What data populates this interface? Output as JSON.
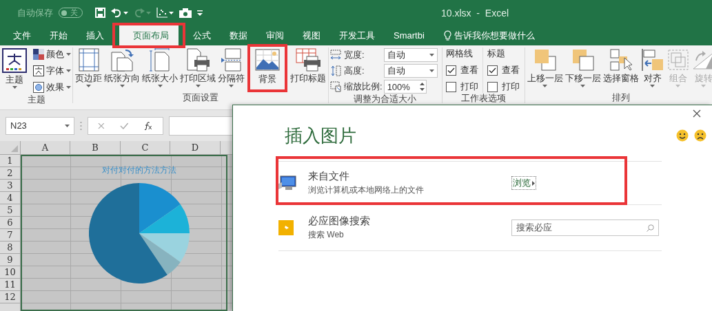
{
  "title_bar": {
    "autosave": {
      "label": "自动保存",
      "state_label": "关",
      "on": false
    },
    "title": "10.xlsx  -  Excel"
  },
  "tabs": [
    {
      "label": "文件",
      "selected": false,
      "highlighted": false
    },
    {
      "label": "开始",
      "selected": false,
      "highlighted": false
    },
    {
      "label": "插入",
      "selected": false,
      "highlighted": false
    },
    {
      "label": "页面布局",
      "selected": true,
      "highlighted": true
    },
    {
      "label": "公式",
      "selected": false,
      "highlighted": false
    },
    {
      "label": "数据",
      "selected": false,
      "highlighted": false
    },
    {
      "label": "审阅",
      "selected": false,
      "highlighted": false
    },
    {
      "label": "视图",
      "selected": false,
      "highlighted": false
    },
    {
      "label": "开发工具",
      "selected": false,
      "highlighted": false
    },
    {
      "label": "Smartbi",
      "selected": false,
      "highlighted": false
    }
  ],
  "tell_me": "告诉我你想要做什么",
  "ribbon": [
    {
      "label": "主题",
      "items": [
        {
          "kind": "large",
          "label": "主题",
          "menu": true,
          "disabled": false,
          "highlighted": false
        },
        {
          "kind": "stack",
          "items": [
            {
              "label": "颜色"
            },
            {
              "label": "字体"
            },
            {
              "label": "效果"
            }
          ]
        }
      ]
    },
    {
      "label": "页面设置",
      "items": [
        {
          "kind": "large",
          "label": "页边距",
          "menu": true,
          "disabled": false,
          "highlighted": false
        },
        {
          "kind": "large",
          "label": "纸张方向",
          "menu": true,
          "disabled": false,
          "highlighted": false
        },
        {
          "kind": "large",
          "label": "纸张大小",
          "menu": true,
          "disabled": false,
          "highlighted": false
        },
        {
          "kind": "large",
          "label": "打印区域",
          "menu": true,
          "disabled": false,
          "highlighted": false
        },
        {
          "kind": "large",
          "label": "分隔符",
          "menu": true,
          "disabled": false,
          "highlighted": false
        },
        {
          "kind": "large",
          "label": "背景",
          "menu": false,
          "disabled": false,
          "highlighted": true
        },
        {
          "kind": "large",
          "label": "打印标题",
          "menu": false,
          "disabled": false,
          "highlighted": false
        }
      ]
    },
    {
      "label": "调整为合适大小",
      "items": [
        {
          "kind": "fields",
          "items": [
            {
              "label": "宽度:",
              "value": "自动",
              "kind": "combo"
            },
            {
              "label": "高度:",
              "value": "自动",
              "kind": "combo"
            },
            {
              "label": "缩放比例:",
              "value": "100%",
              "kind": "spinner"
            }
          ]
        }
      ]
    },
    {
      "label": "工作表选项",
      "items": [
        {
          "kind": "checks",
          "header": "网格线",
          "items": [
            {
              "label": "查看",
              "checked": true
            },
            {
              "label": "打印",
              "checked": false
            }
          ]
        },
        {
          "kind": "checks",
          "header": "标题",
          "items": [
            {
              "label": "查看",
              "checked": true
            },
            {
              "label": "打印",
              "checked": false
            }
          ]
        }
      ]
    },
    {
      "label": "排列",
      "items": [
        {
          "kind": "large",
          "label": "上移一层",
          "menu": true,
          "disabled": false,
          "highlighted": false
        },
        {
          "kind": "large",
          "label": "下移一层",
          "menu": true,
          "disabled": false,
          "highlighted": false
        },
        {
          "kind": "large",
          "label": "选择窗格",
          "menu": false,
          "disabled": false,
          "highlighted": false
        },
        {
          "kind": "large",
          "label": "对齐",
          "menu": true,
          "disabled": false,
          "highlighted": false
        },
        {
          "kind": "large",
          "label": "组合",
          "menu": true,
          "disabled": true,
          "highlighted": false
        },
        {
          "kind": "large",
          "label": "旋转",
          "menu": true,
          "disabled": true,
          "highlighted": false
        }
      ]
    }
  ],
  "formula_bar": {
    "name_box": "N23"
  },
  "sheet": {
    "columns": [
      "A",
      "B",
      "C",
      "D"
    ],
    "rows": [
      "1",
      "2",
      "3",
      "4",
      "5",
      "6",
      "7",
      "8",
      "9",
      "10",
      "11",
      "12"
    ],
    "chart": {
      "title": "对付对付的方法方法"
    }
  },
  "dialog": {
    "title": "插入图片",
    "sources": [
      {
        "kind": "file",
        "title": "来自文件",
        "subtitle": "浏览计算机或本地网络上的文件",
        "action": "浏览",
        "highlighted": true
      },
      {
        "kind": "search",
        "title": "必应图像搜索",
        "subtitle": "搜索 Web",
        "placeholder": "搜索必应",
        "highlighted": false
      }
    ]
  }
}
